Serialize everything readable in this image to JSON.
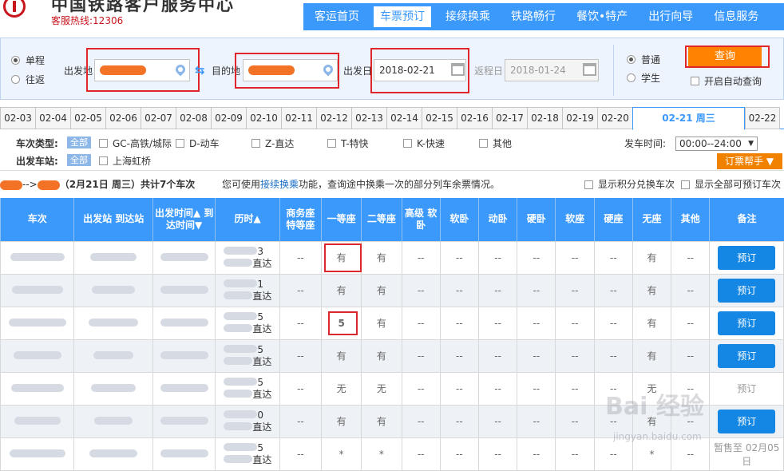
{
  "header": {
    "brand": "中国铁路客户服务中心",
    "hotline": "客服热线:12306"
  },
  "nav": [
    {
      "label": "客运首页"
    },
    {
      "label": "车票预订"
    },
    {
      "label": "接续换乘"
    },
    {
      "label": "铁路畅行"
    },
    {
      "label": "餐饮•特产"
    },
    {
      "label": "出行向导"
    },
    {
      "label": "信息服务"
    }
  ],
  "query": {
    "trip_oneway": "单程",
    "trip_round": "往返",
    "from_label": "出发地",
    "to_label": "目的地",
    "depart_label": "出发日",
    "depart_value": "2018-02-21",
    "return_label": "返程日",
    "return_value": "2018-01-24",
    "ticket_adult": "普通",
    "ticket_student": "学生",
    "search_label": "查询",
    "auto_query": "开启自动查询"
  },
  "dates": [
    "02-03",
    "02-04",
    "02-05",
    "02-06",
    "02-07",
    "02-08",
    "02-09",
    "02-10",
    "02-11",
    "02-12",
    "02-13",
    "02-14",
    "02-15",
    "02-16",
    "02-17",
    "02-18",
    "02-19",
    "02-20",
    "02-21 周三",
    "02-22"
  ],
  "filters": {
    "train_type_label": "车次类型:",
    "all": "全部",
    "types": [
      "GC-高铁/城际",
      "D-动车",
      "Z-直达",
      "T-特快",
      "K-快速",
      "其他"
    ],
    "station_label": "出发车站:",
    "station": "上海虹桥",
    "time_label": "发车时间:",
    "time_value": "00:00--24:00",
    "help": "订票帮手 ▼"
  },
  "summary": {
    "arrow": "-->",
    "date_info": "（2月21日 周三）共计7个车次",
    "tip_pre": "您可使用",
    "tip_link": "接续换乘",
    "tip_post": "功能，查询途中换乘一次的部分列车余票情况。",
    "opt1": "显示积分兑换车次",
    "opt2": "显示全部可预订车次"
  },
  "table": {
    "headers": [
      "车次",
      "出发站 到达站",
      "出发时间▲ 到达时间▼",
      "历时▲",
      "商务座 特等座",
      "一等座",
      "二等座",
      "高级 软卧",
      "软卧",
      "动卧",
      "硬卧",
      "软座",
      "硬座",
      "无座",
      "其他",
      "备注"
    ],
    "rows": [
      {
        "suffix": "3",
        "tag": "直达",
        "cells": [
          "--",
          "有",
          "有",
          "--",
          "--",
          "--",
          "--",
          "--",
          "--",
          "有",
          "--"
        ],
        "action": "预订"
      },
      {
        "suffix": "1",
        "tag": "直达",
        "cells": [
          "--",
          "有",
          "有",
          "--",
          "--",
          "--",
          "--",
          "--",
          "--",
          "有",
          "--"
        ],
        "action": "预订"
      },
      {
        "suffix": "5",
        "tag": "直达",
        "cells": [
          "--",
          "5",
          "有",
          "--",
          "--",
          "--",
          "--",
          "--",
          "--",
          "有",
          "--"
        ],
        "action": "预订"
      },
      {
        "suffix": "5",
        "tag": "直达",
        "cells": [
          "--",
          "有",
          "有",
          "--",
          "--",
          "--",
          "--",
          "--",
          "--",
          "有",
          "--"
        ],
        "action": "预订"
      },
      {
        "suffix": "5",
        "tag": "直达",
        "cells": [
          "--",
          "无",
          "无",
          "--",
          "--",
          "--",
          "--",
          "--",
          "--",
          "无",
          "--"
        ],
        "action": "预订"
      },
      {
        "suffix": "0",
        "tag": "直达",
        "cells": [
          "--",
          "有",
          "有",
          "--",
          "--",
          "--",
          "--",
          "--",
          "--",
          "有",
          "--"
        ],
        "action": "预订"
      },
      {
        "suffix": "5",
        "tag": "直达",
        "cells": [
          "--",
          "*",
          "*",
          "--",
          "--",
          "--",
          "--",
          "--",
          "--",
          "*",
          "--"
        ],
        "action": "暂售至 02月05日"
      }
    ]
  },
  "watermark": {
    "main": "Bai 经验",
    "sub": "jingyan.baidu.com"
  },
  "colors": {
    "nav": "#3b99fc",
    "search": "#ff8200",
    "book": "#1387e3",
    "available": "#188a0d",
    "highlight": "#e0262b"
  }
}
